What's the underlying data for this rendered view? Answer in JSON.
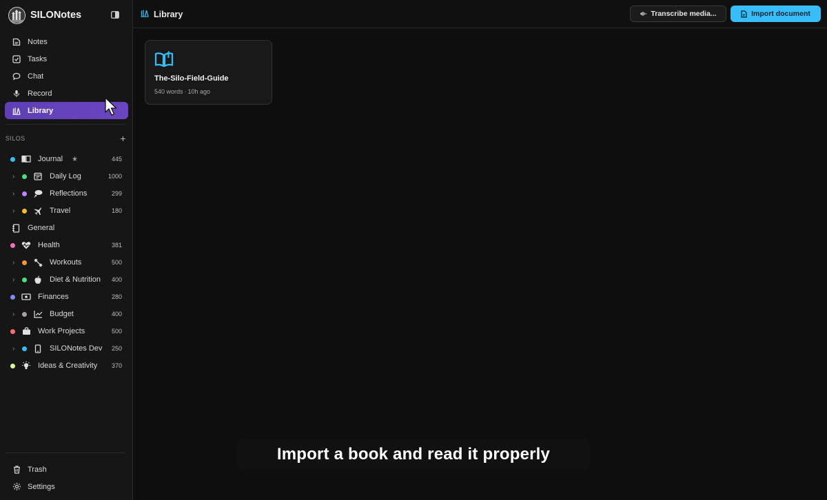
{
  "app": {
    "name": "SILONotes"
  },
  "nav": {
    "items": [
      {
        "label": "Notes",
        "icon": "notes-icon"
      },
      {
        "label": "Tasks",
        "icon": "tasks-icon"
      },
      {
        "label": "Chat",
        "icon": "chat-icon"
      },
      {
        "label": "Record",
        "icon": "microphone-icon"
      },
      {
        "label": "Library",
        "icon": "library-icon",
        "active": true
      }
    ]
  },
  "silos": {
    "header": "SILOS",
    "add_label": "+",
    "items": [
      {
        "name": "Journal",
        "count": "445",
        "dot": "#38bdf8",
        "icon": "journal-icon",
        "starred": true,
        "star": "★"
      },
      {
        "name": "Daily Log",
        "count": "1000",
        "dot": "#4ade80",
        "icon": "calendar-icon",
        "child": true
      },
      {
        "name": "Reflections",
        "count": "299",
        "dot": "#c084fc",
        "icon": "thought-bubble-icon",
        "child": true
      },
      {
        "name": "Travel",
        "count": "180",
        "dot": "#fbbf24",
        "icon": "airplane-icon",
        "child": true
      },
      {
        "name": "General",
        "count": "",
        "dot": "",
        "icon": "notebook-icon"
      },
      {
        "name": "Health",
        "count": "381",
        "dot": "#f472b6",
        "icon": "heartbeat-icon"
      },
      {
        "name": "Workouts",
        "count": "500",
        "dot": "#fb923c",
        "icon": "dumbbell-icon",
        "child": true
      },
      {
        "name": "Diet & Nutrition",
        "count": "400",
        "dot": "#4ade80",
        "icon": "apple-icon",
        "child": true
      },
      {
        "name": "Finances",
        "count": "280",
        "dot": "#818cf8",
        "icon": "money-icon"
      },
      {
        "name": "Budget",
        "count": "400",
        "dot": "#a8a29e",
        "icon": "chart-icon",
        "child": true
      },
      {
        "name": "Work Projects",
        "count": "500",
        "dot": "#f87171",
        "icon": "briefcase-icon"
      },
      {
        "name": "SILONotes Dev",
        "count": "250",
        "dot": "#38bdf8",
        "icon": "phone-icon",
        "child": true
      },
      {
        "name": "Ideas & Creativity",
        "count": "370",
        "dot": "#d9f99d",
        "icon": "lightbulb-icon"
      }
    ]
  },
  "footer": {
    "trash": "Trash",
    "settings": "Settings"
  },
  "topbar": {
    "title": "Library",
    "transcribe_label": "Transcribe media...",
    "import_label": "Import document"
  },
  "documents": [
    {
      "title": "The-Silo-Field-Guide",
      "words": "540 words",
      "sep": "·",
      "age": "10h ago"
    }
  ],
  "caption": "Import a book and read it properly",
  "colors": {
    "accent": "#38bdf8",
    "active_nav": "#6a45c0",
    "background": "#0f0e0f",
    "sidebar": "#171617"
  }
}
